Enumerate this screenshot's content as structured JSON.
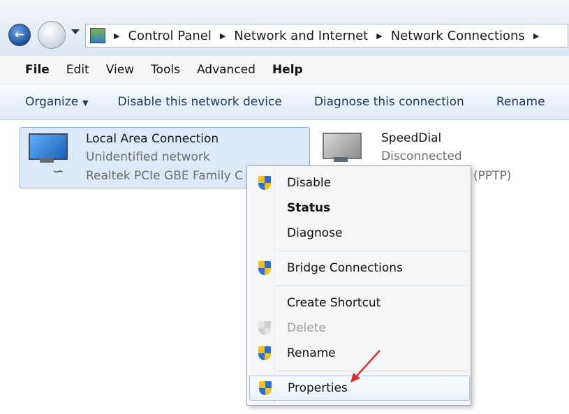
{
  "breadcrumb": [
    "Control Panel",
    "Network and Internet",
    "Network Connections"
  ],
  "menu": [
    "File",
    "Edit",
    "View",
    "Tools",
    "Advanced",
    "Help"
  ],
  "commands": {
    "organize": "Organize",
    "disable": "Disable this network device",
    "diagnose": "Diagnose this connection",
    "rename": "Rename"
  },
  "connections": [
    {
      "name": "Local Area Connection",
      "status": "Unidentified network",
      "device": "Realtek PCIe GBE Family C"
    },
    {
      "name": "SpeedDial",
      "status": "Disconnected",
      "device": "(PPTP)"
    }
  ],
  "context_menu": {
    "disable": "Disable",
    "status": "Status",
    "diagnose": "Diagnose",
    "bridge": "Bridge Connections",
    "shortcut": "Create Shortcut",
    "delete": "Delete",
    "rename": "Rename",
    "properties": "Properties"
  },
  "colors": {
    "annotation_arrow": "#e0302a",
    "selection": "#dce9f8"
  }
}
